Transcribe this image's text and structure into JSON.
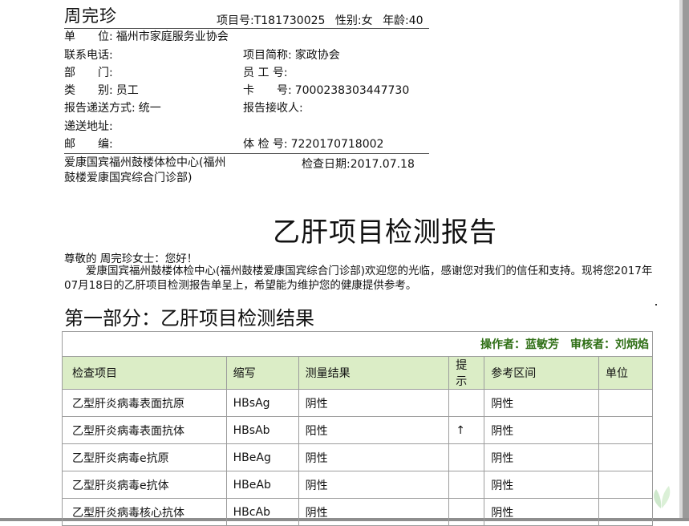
{
  "header": {
    "name": "周完珍",
    "project_no": "项目号:T181730025",
    "gender": "性别:女",
    "age": "年龄:40"
  },
  "fields": [
    {
      "label": "单　　位:",
      "value": "福州市家庭服务业协会"
    },
    {
      "label": "联系电话:",
      "value": ""
    },
    {
      "label": "项目简称:",
      "value": "家政协会"
    },
    {
      "label": "部　　门:",
      "value": ""
    },
    {
      "label": "员 工 号:",
      "value": ""
    },
    {
      "label": "类　　别:",
      "value": "员工"
    },
    {
      "label": "卡　　号:",
      "value": "7000238303447730"
    },
    {
      "label": "报告递送方式:",
      "value": "统一"
    },
    {
      "label": "报告接收人:",
      "value": ""
    },
    {
      "label": "递送地址:",
      "value": ""
    },
    {
      "label": "邮　　编:",
      "value": ""
    },
    {
      "label": "体 检 号:",
      "value": "7220170718002"
    }
  ],
  "center": "爱康国宾福州鼓楼体检中心(福州鼓楼爱康国宾综合门诊部)",
  "exam_date": "检查日期:2017.07.18",
  "report_title": "乙肝项目检测报告",
  "greeting": "尊敬的 周完珍女士：您好！",
  "intro": "爱康国宾福州鼓楼体检中心(福州鼓楼爱康国宾综合门诊部)欢迎您的光临，感谢您对我们的信任和支持。现将您2017年07月18日的乙肝项目检测报告单呈上，希望能为维护您的健康提供参考。",
  "part_title": "第一部分：乙肝项目检测结果",
  "table": {
    "operator": "操作者：蓝敏芳",
    "reviewer": "审核者：刘炳焰",
    "columns": [
      "检查项目",
      "缩写",
      "测量结果",
      "提示",
      "参考区间",
      "单位"
    ],
    "rows": [
      {
        "item": "乙型肝炎病毒表面抗原",
        "abbr": "HBsAg",
        "result": "阴性",
        "hint": "",
        "ref": "阴性",
        "unit": ""
      },
      {
        "item": "乙型肝炎病毒表面抗体",
        "abbr": "HBsAb",
        "result": "阳性",
        "hint": "↑",
        "ref": "阴性",
        "unit": ""
      },
      {
        "item": "乙型肝炎病毒e抗原",
        "abbr": "HBeAg",
        "result": "阴性",
        "hint": "",
        "ref": "阴性",
        "unit": ""
      },
      {
        "item": "乙型肝炎病毒e抗体",
        "abbr": "HBeAb",
        "result": "阴性",
        "hint": "",
        "ref": "阴性",
        "unit": ""
      },
      {
        "item": "乙型肝炎病毒核心抗体",
        "abbr": "HBcAb",
        "result": "阴性",
        "hint": "",
        "ref": "阴性",
        "unit": ""
      }
    ]
  },
  "colors": {
    "header_bg": "#dbedc6",
    "signer_text": "#2f6f16"
  },
  "icons": {
    "corner": "leaf-logo-icon"
  }
}
